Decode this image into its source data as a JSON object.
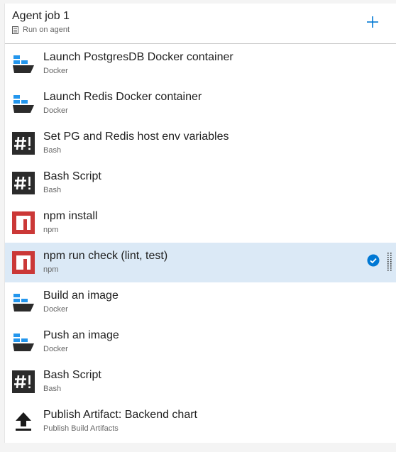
{
  "job": {
    "title": "Agent job 1",
    "subtitle": "Run on agent",
    "subtitle_icon": "server-icon",
    "add_icon": "plus-icon"
  },
  "tasks": [
    {
      "name": "Launch PostgresDB Docker container",
      "type": "Docker",
      "icon": "docker-icon"
    },
    {
      "name": "Launch Redis Docker container",
      "type": "Docker",
      "icon": "docker-icon"
    },
    {
      "name": "Set PG and Redis host env variables",
      "type": "Bash",
      "icon": "bash-icon"
    },
    {
      "name": "Bash Script",
      "type": "Bash",
      "icon": "bash-icon"
    },
    {
      "name": "npm install",
      "type": "npm",
      "icon": "npm-icon"
    },
    {
      "name": "npm run check (lint, test)",
      "type": "npm",
      "icon": "npm-icon",
      "selected": true
    },
    {
      "name": "Build an image",
      "type": "Docker",
      "icon": "docker-icon"
    },
    {
      "name": "Push an image",
      "type": "Docker",
      "icon": "docker-icon"
    },
    {
      "name": "Bash Script",
      "type": "Bash",
      "icon": "bash-icon"
    },
    {
      "name": "Publish Artifact: Backend chart",
      "type": "Publish Build Artifacts",
      "icon": "upload-icon"
    }
  ],
  "colors": {
    "accent": "#0078d4",
    "selected_bg": "#dbe9f6",
    "docker": "#2396ed",
    "npm": "#cb3837",
    "bash": "#2b2b2b"
  }
}
